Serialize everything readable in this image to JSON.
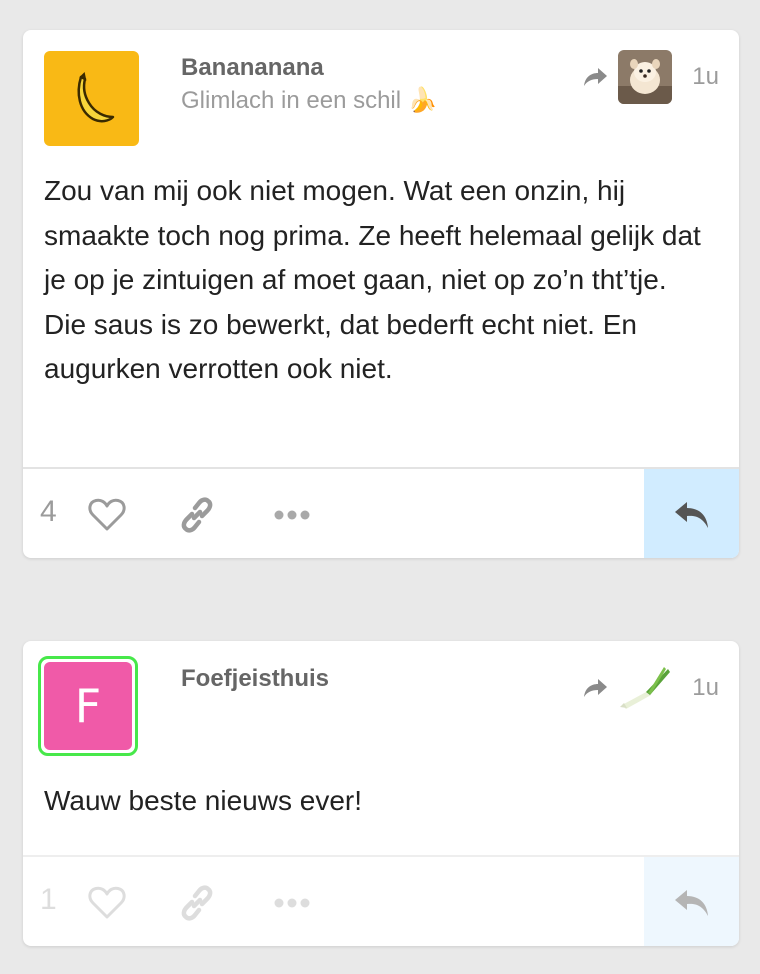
{
  "posts": [
    {
      "author": "Banananana",
      "subtitle": "Glimlach in een schil 🍌",
      "avatar_glyph": "🍌",
      "avatar_color": "#f9b915",
      "time": "1u",
      "body": "Zou van mij ook niet mogen. Wat een onzin, hij smaakte toch nog prima. Ze heeft helemaal gelijk dat je op je zintuigen af moet gaan, niet op zo’n tht’tje. Die saus is zo bewerkt, dat bederft echt niet. En augurken verrotten ook niet.",
      "likes": "4",
      "thumbnail_icon": "dog-photo",
      "reply_bg": "#d1ecff"
    },
    {
      "author": "Foefjeisthuis",
      "subtitle": "",
      "avatar_glyph": "F",
      "avatar_color": "#f05aa8",
      "avatar_ring_color": "#47e84a",
      "time": "1u",
      "body": "Wauw beste nieuws ever!",
      "likes": "1",
      "thumbnail_icon": "leek-photo",
      "reply_bg": "#eef7fe"
    }
  ],
  "colors": {
    "background": "#e9e9e9",
    "muted": "#9b9b9b",
    "text": "#222222",
    "icon": "#9b9b9b"
  }
}
